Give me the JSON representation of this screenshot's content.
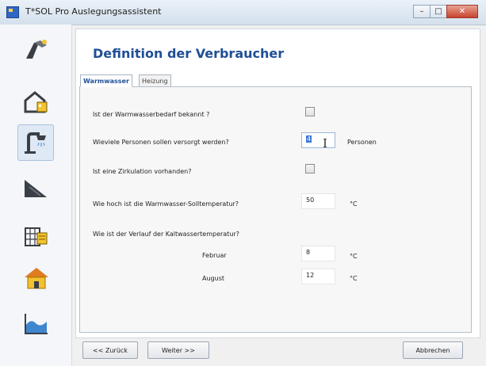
{
  "window": {
    "title": "T*SOL Pro Auslegungsassistent",
    "minimize_glyph": "–",
    "maximize_glyph": "□",
    "close_glyph": "✕"
  },
  "sidebar": {
    "items": [
      {
        "icon": "collector-wrench-icon"
      },
      {
        "icon": "building-lock-icon"
      },
      {
        "icon": "shower-icon",
        "active": true
      },
      {
        "icon": "roof-icon"
      },
      {
        "icon": "building-grid-icon"
      },
      {
        "icon": "house-icon"
      },
      {
        "icon": "chart-icon"
      }
    ]
  },
  "main": {
    "title": "Definition der Verbraucher",
    "tabs": [
      {
        "label": "Warmwasser",
        "active": true
      },
      {
        "label": "Heizung",
        "active": false
      }
    ],
    "form": {
      "q_known": {
        "label": "Ist der Warmwasserbedarf bekannt ?",
        "checked": false
      },
      "q_persons": {
        "label": "Wieviele Personen sollen versorgt werden?",
        "value": "4",
        "unit": "Personen"
      },
      "q_circulation": {
        "label": "Ist eine Zirkulation vorhanden?",
        "checked": false
      },
      "q_temperature": {
        "label": "Wie hoch ist die Warmwasser-Solltemperatur?",
        "value": "50",
        "unit": "°C"
      },
      "q_coldwater": {
        "label": "Wie ist der Verlauf der Kaltwassertemperatur?"
      },
      "february": {
        "label": "Februar",
        "value": "8",
        "unit": "°C"
      },
      "august": {
        "label": "August",
        "value": "12",
        "unit": "°C"
      }
    }
  },
  "footer": {
    "back_label": "<< Zurück",
    "next_label": "Weiter >>",
    "cancel_label": "Abbrechen"
  },
  "colors": {
    "title_blue": "#1f4f96",
    "accent_yellow": "#f2c230",
    "icon_dark": "#3a3f47"
  }
}
